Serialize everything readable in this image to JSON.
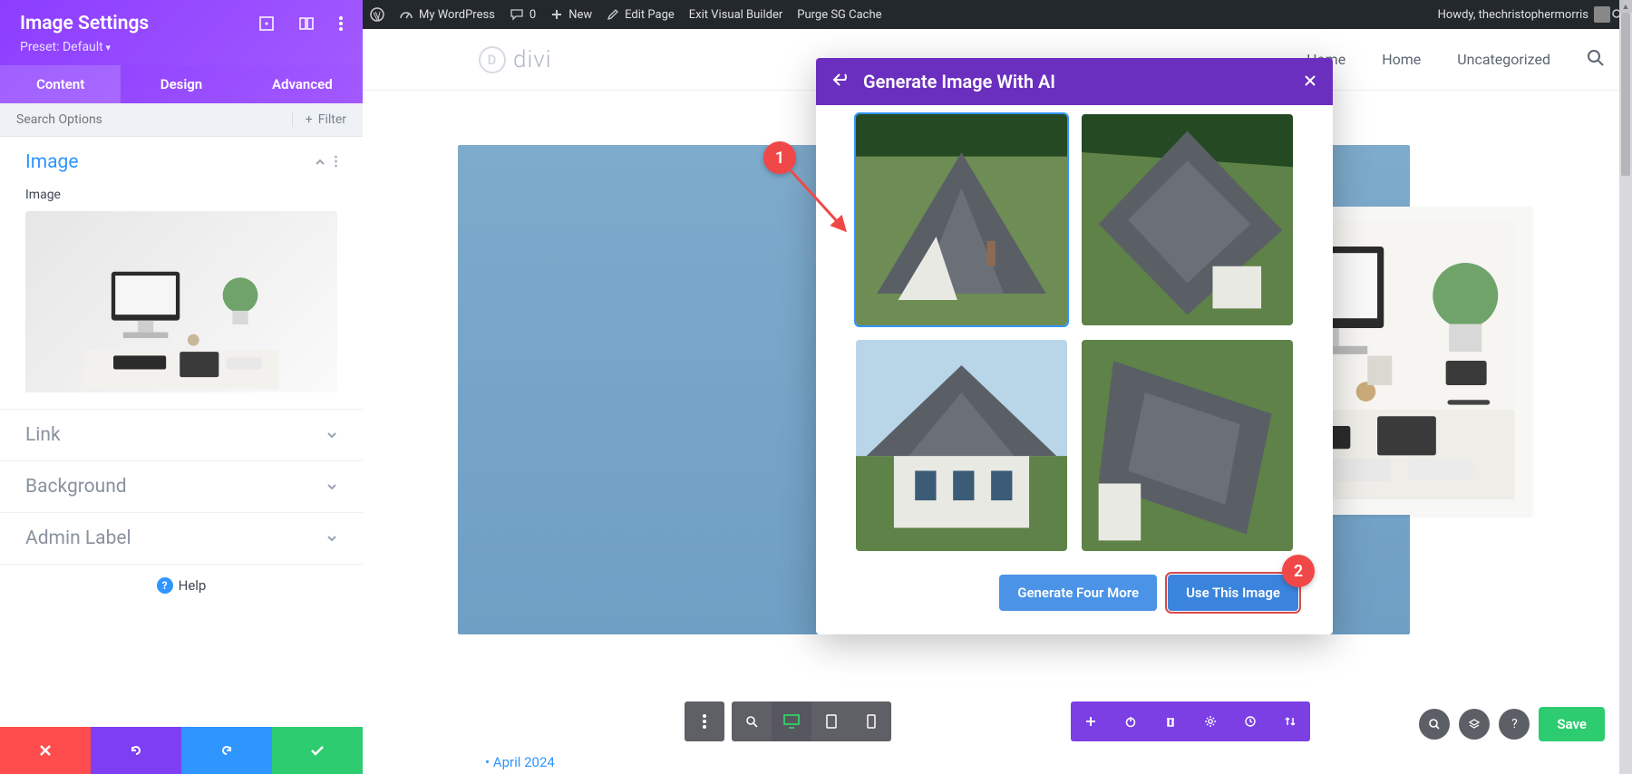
{
  "sidebar": {
    "title": "Image Settings",
    "preset": "Preset: Default",
    "tabs": {
      "content": "Content",
      "design": "Design",
      "advanced": "Advanced"
    },
    "search_placeholder": "Search Options",
    "filter_label": "Filter",
    "sections": {
      "image": {
        "title": "Image",
        "field_label": "Image"
      },
      "link": {
        "title": "Link"
      },
      "background": {
        "title": "Background"
      },
      "admin_label": {
        "title": "Admin Label"
      }
    },
    "help": "Help"
  },
  "wpbar": {
    "site": "My WordPress",
    "comments": "0",
    "new": "New",
    "edit": "Edit Page",
    "exit": "Exit Visual Builder",
    "purge": "Purge SG Cache",
    "howdy": "Howdy, thechristophermorris"
  },
  "nav": {
    "logo": "divi",
    "links": {
      "home1": "Home",
      "home2": "Home",
      "uncat": "Uncategorized"
    }
  },
  "modal": {
    "title": "Generate Image With AI",
    "generate_more": "Generate Four More",
    "use_image": "Use This Image"
  },
  "callouts": {
    "one": "1",
    "two": "2"
  },
  "archive": "April 2024",
  "save": "Save",
  "help_q": "?"
}
